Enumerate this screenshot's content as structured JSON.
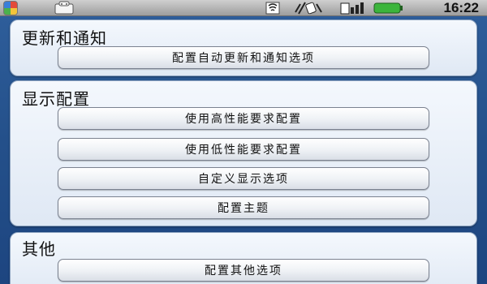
{
  "status_bar": {
    "time": "16:22",
    "icons": [
      "app-icon",
      "android-icon",
      "signal-icon",
      "vibrate-icon",
      "sim-icon",
      "battery-icon"
    ]
  },
  "sections": [
    {
      "title": "更新和通知",
      "buttons": [
        "配置自动更新和通知选项"
      ]
    },
    {
      "title": "显示配置",
      "buttons": [
        "使用高性能要求配置",
        "使用低性能要求配置",
        "自定义显示选项",
        "配置主题"
      ]
    },
    {
      "title": "其他",
      "buttons": [
        "配置其他选项"
      ]
    }
  ],
  "colors": {
    "background": "#24508a",
    "card": "#e8eff8",
    "status_bar": "#b5b5b5"
  }
}
